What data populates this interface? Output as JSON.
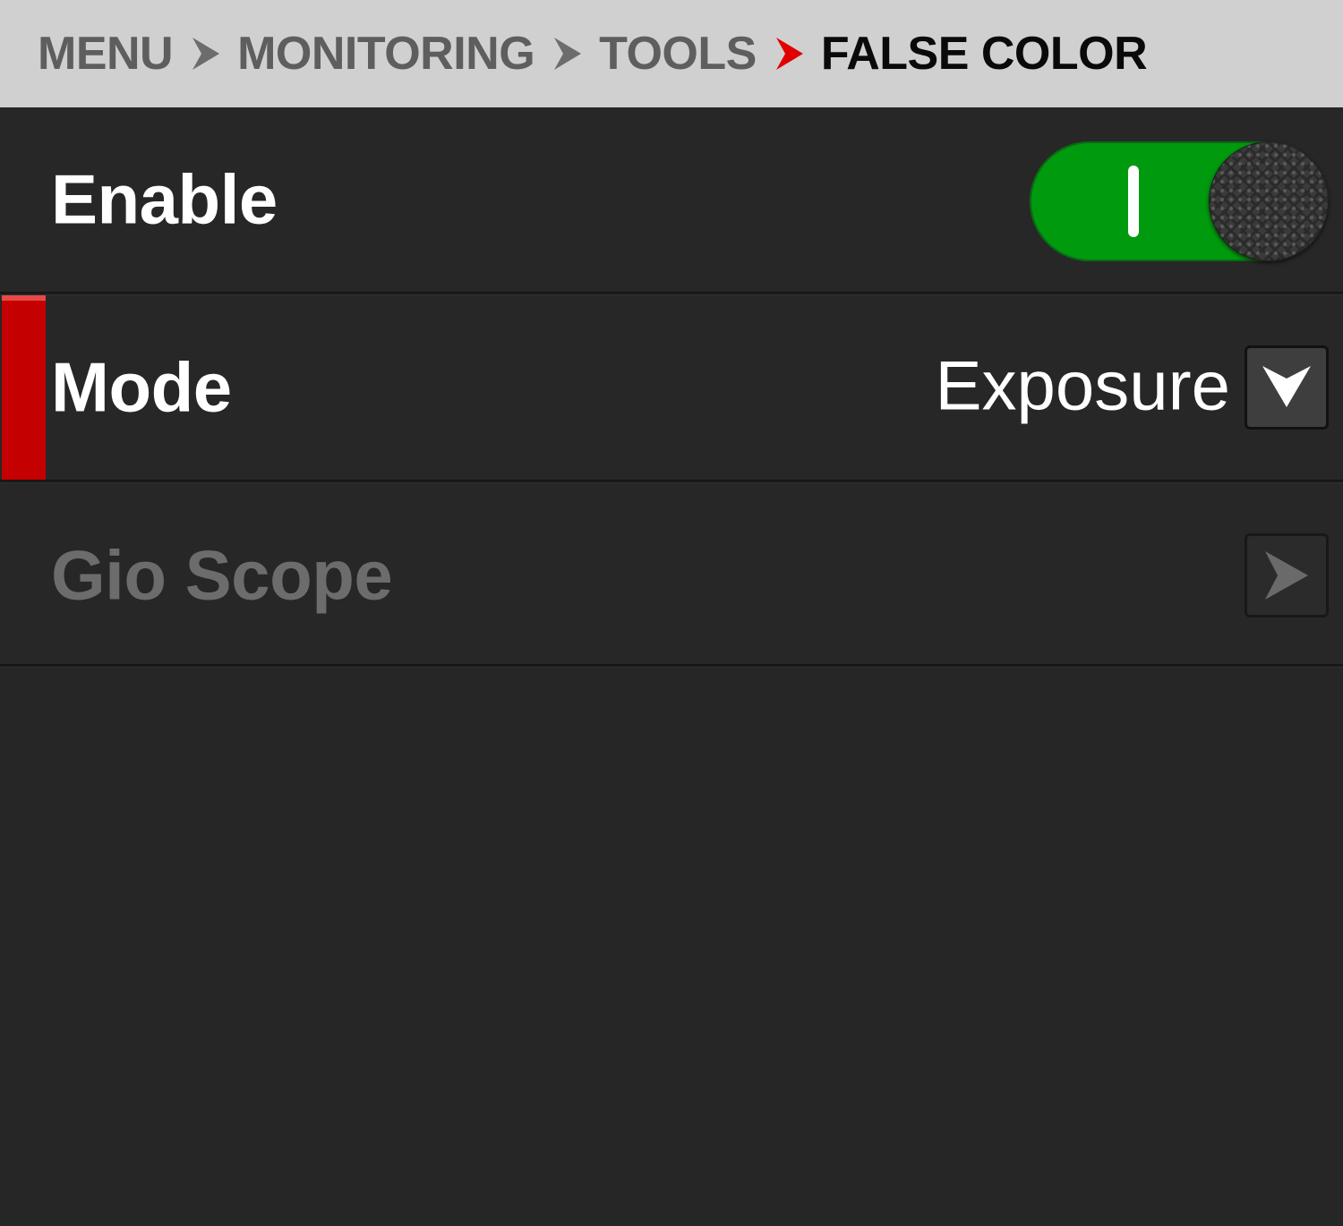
{
  "breadcrumb": {
    "items": [
      {
        "label": "MENU"
      },
      {
        "label": "MONITORING"
      },
      {
        "label": "TOOLS"
      },
      {
        "label": "FALSE COLOR"
      }
    ],
    "separator_icon": "chevron-right-icon",
    "colors": {
      "inactive_separator": "#6c6c6c",
      "active_separator": "#e00000"
    }
  },
  "rows": {
    "enable": {
      "label": "Enable",
      "toggle_state": "on",
      "toggle_color": "#009a0e"
    },
    "mode": {
      "label": "Mode",
      "value": "Exposure",
      "selected": true,
      "button_icon": "dropdown-arrow-icon",
      "highlight_color": "#c50000"
    },
    "gio_scope": {
      "label": "Gio Scope",
      "disabled": true,
      "button_icon": "arrow-right-icon"
    }
  }
}
